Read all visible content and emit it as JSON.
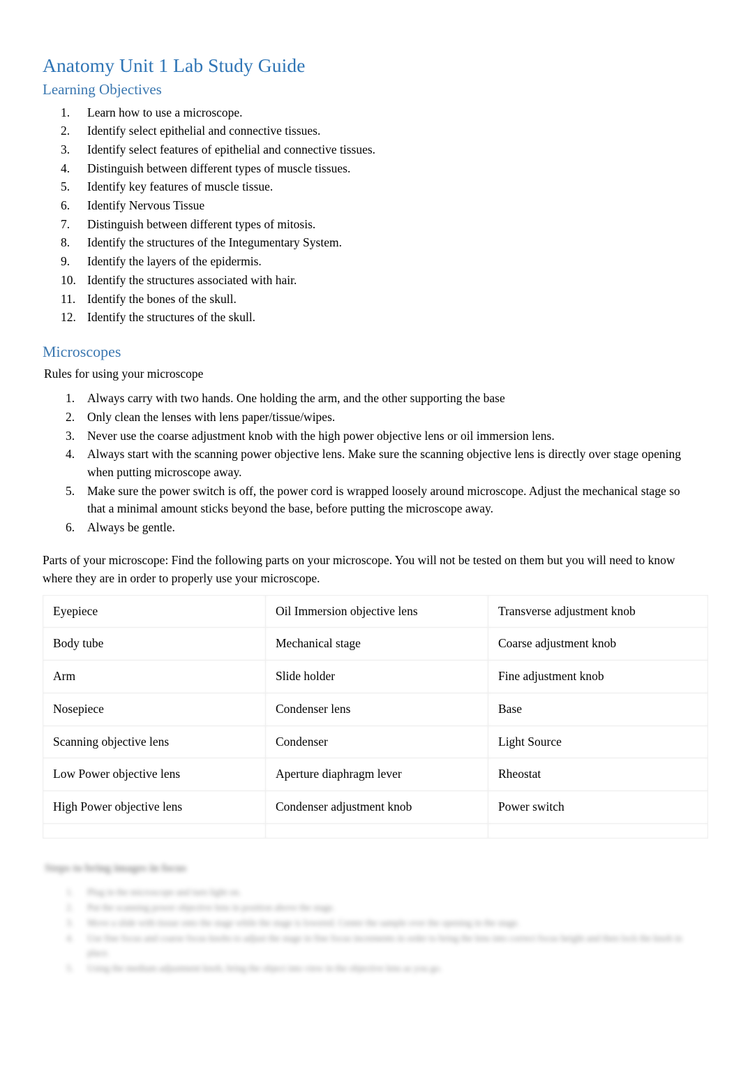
{
  "document": {
    "title": "Anatomy Unit 1 Lab Study Guide",
    "accent_color": "#2E74B5",
    "heading_color": "#3A77B0",
    "body_color": "#000000"
  },
  "learning_objectives": {
    "heading": "Learning Objectives",
    "items": [
      "Learn how to use a microscope.",
      "Identify select epithelial and connective tissues.",
      "Identify select features of epithelial and connective tissues.",
      "Distinguish between different types of muscle tissues.",
      "Identify key features of muscle tissue.",
      "Identify Nervous Tissue",
      "Distinguish between different types of mitosis.",
      "Identify the structures of the Integumentary System.",
      "Identify the layers of the epidermis.",
      "Identify the structures associated with hair.",
      "Identify the bones of the skull.",
      "Identify the structures of the skull."
    ]
  },
  "microscopes": {
    "heading": "Microscopes",
    "rules_intro": "Rules for using your microscope",
    "rules": [
      "Always carry with two hands.  One holding the arm, and the other supporting the base",
      "Only clean the lenses with lens paper/tissue/wipes.",
      "Never use the coarse adjustment knob with the high power objective lens or oil immersion lens.",
      "Always start with the scanning power objective lens.   Make sure the scanning objective lens is directly over stage opening when putting microscope away.",
      "Make sure the power switch is off, the power cord is wrapped loosely around microscope. Adjust the mechanical stage so that a minimal amount sticks beyond the base, before putting the microscope away.",
      "Always be gentle."
    ],
    "parts_intro": "Parts of your microscope:   Find the following parts on your microscope.  You will not be tested on them   but you will need to know where they are in order to properly use your microscope.",
    "parts_table": {
      "rows": [
        [
          "Eyepiece",
          "Oil Immersion objective lens",
          "Transverse adjustment knob"
        ],
        [
          "Body tube",
          "Mechanical stage",
          "Coarse adjustment knob"
        ],
        [
          "Arm",
          "Slide holder",
          "Fine adjustment knob"
        ],
        [
          "Nosepiece",
          "Condenser lens",
          "Base"
        ],
        [
          "Scanning objective lens",
          "Condenser",
          "Light Source"
        ],
        [
          "Low Power objective lens",
          "Aperture diaphragm lever",
          "Rheostat"
        ],
        [
          "High Power objective lens",
          "Condenser adjustment knob",
          "Power switch"
        ]
      ]
    }
  },
  "obscured_section": {
    "heading": "Steps to bring images in focus",
    "items": [
      "Plug in the microscope and turn light on.",
      "Put the scanning power objective lens in position above the stage.",
      "Move a slide with tissue onto the stage while the stage is lowered. Center the sample over the opening in the stage.",
      "Use fine focus and coarse focus knobs to adjust the stage in fine focus increments in order to bring the lens into correct focus height and then lock the knob in place.",
      "Using the medium adjustment knob, bring the object into view in the objective lens as you go."
    ]
  }
}
